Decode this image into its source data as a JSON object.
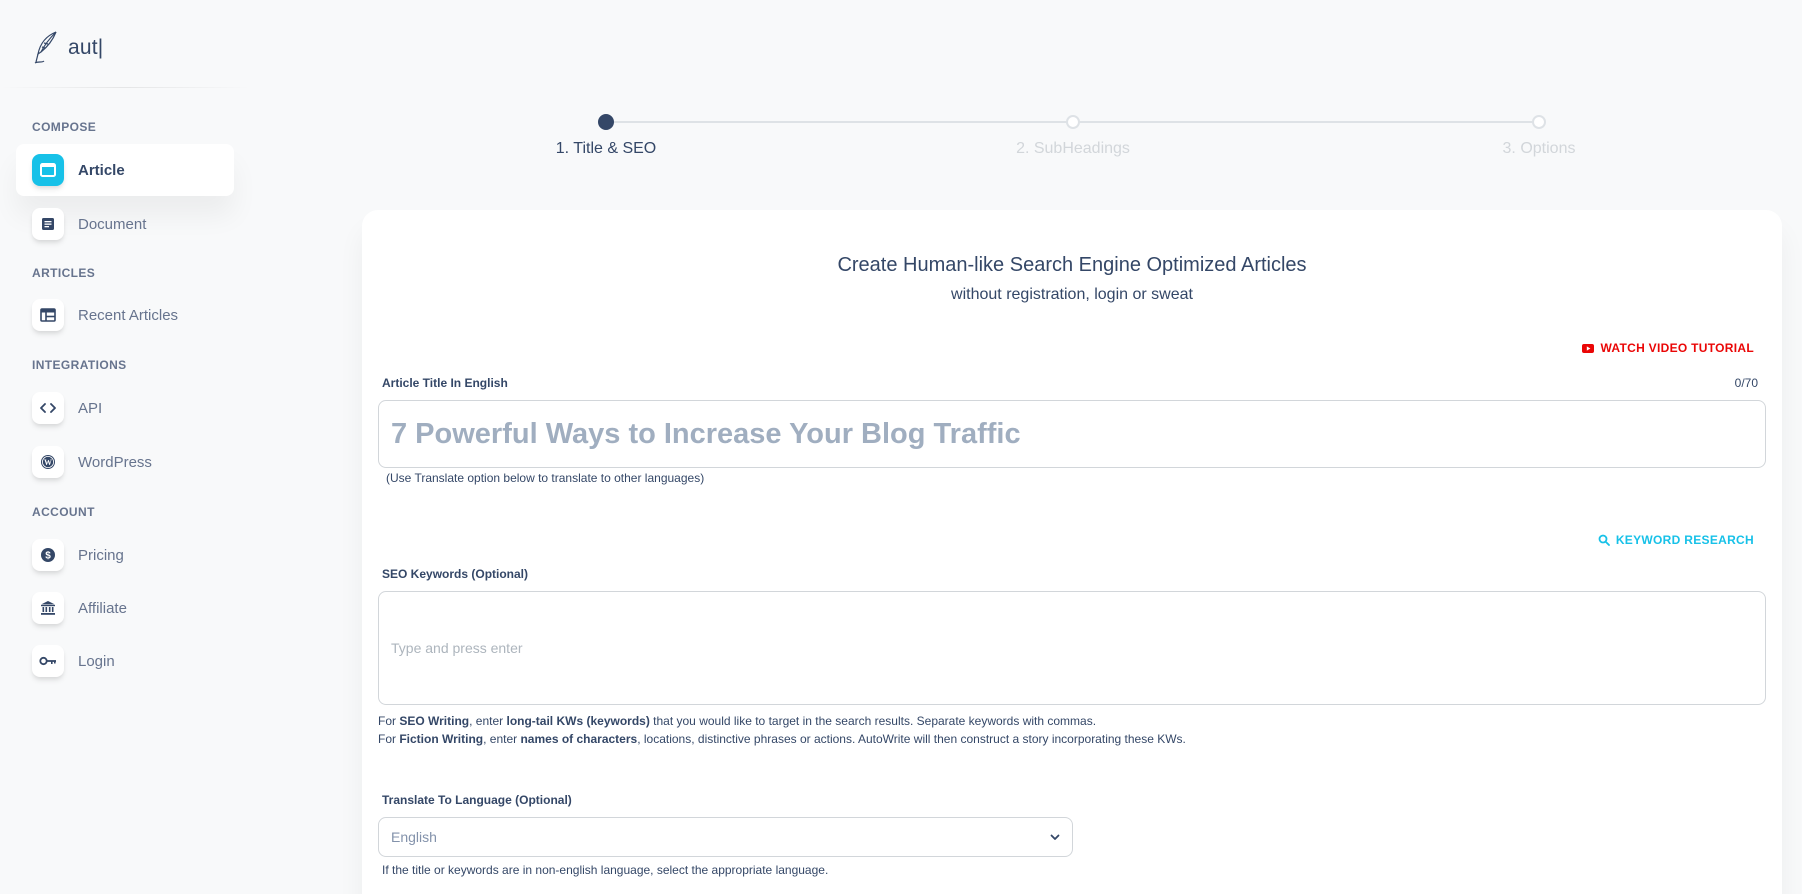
{
  "brand": {
    "name": "aut|"
  },
  "sidebar": {
    "sections": [
      {
        "title": "COMPOSE"
      },
      {
        "title": "ARTICLES"
      },
      {
        "title": "INTEGRATIONS"
      },
      {
        "title": "ACCOUNT"
      }
    ],
    "items": [
      {
        "label": "Article",
        "icon": "browser-window-icon",
        "active": true
      },
      {
        "label": "Document",
        "icon": "document-icon"
      },
      {
        "label": "Recent Articles",
        "icon": "table-icon"
      },
      {
        "label": "API",
        "icon": "code-icon"
      },
      {
        "label": "WordPress",
        "icon": "wordpress-icon"
      },
      {
        "label": "Pricing",
        "icon": "dollar-icon"
      },
      {
        "label": "Affiliate",
        "icon": "bank-icon"
      },
      {
        "label": "Login",
        "icon": "key-icon"
      }
    ]
  },
  "stepper": {
    "steps": [
      {
        "label": "1. Title & SEO",
        "active": true
      },
      {
        "label": "2. SubHeadings",
        "active": false
      },
      {
        "label": "3. Options",
        "active": false
      }
    ]
  },
  "card": {
    "title": "Create Human-like Search Engine Optimized Articles",
    "subtitle": "without registration, login or sweat",
    "video_link": "WATCH VIDEO TUTORIAL",
    "title_field": {
      "label": "Article Title In English",
      "counter": "0/70",
      "value": "",
      "placeholder": "7 Powerful Ways to Increase Your Blog Traffic",
      "hint": "(Use Translate option below to translate to other languages)"
    },
    "keyword_research": "KEYWORD RESEARCH",
    "keywords_field": {
      "label": "SEO Keywords (Optional)",
      "value": "",
      "placeholder": "Type and press enter"
    },
    "help": {
      "line1": {
        "p1": "For ",
        "b1": "SEO Writing",
        "p2": ", enter ",
        "b2": "long-tail KWs (keywords)",
        "p3": " that you would like to target in the search results. Separate keywords with commas."
      },
      "line2": {
        "p1": "For ",
        "b1": "Fiction Writing",
        "p2": ", enter ",
        "b2": "names of characters",
        "p3": ", locations, distinctive phrases or actions. AutoWrite will then construct a story incorporating these KWs."
      }
    },
    "language_field": {
      "label": "Translate To Language (Optional)",
      "value": "English",
      "hint": "If the title or keywords are in non-english language, select the appropriate language."
    }
  },
  "colors": {
    "primary_text": "#344767",
    "muted_text": "#67748e",
    "accent_info": "#17c1e8",
    "accent_danger": "#ea0606"
  }
}
